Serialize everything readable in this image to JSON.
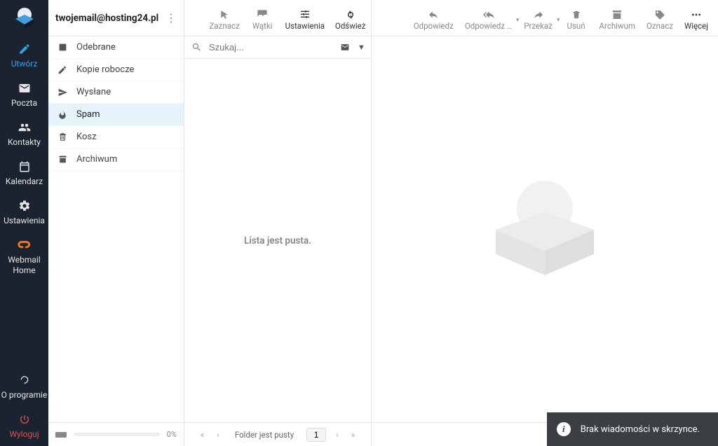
{
  "account": "twojemail@hosting24.pl",
  "vnav": {
    "compose": "Utwórz",
    "mail": "Poczta",
    "contacts": "Kontakty",
    "calendar": "Kalendarz",
    "settings": "Ustawienia",
    "webmail_home_l1": "Webmail",
    "webmail_home_l2": "Home",
    "about": "O programie",
    "logout": "Wyloguj"
  },
  "toolbar_left": {
    "select": "Zaznacz",
    "threads": "Wątki",
    "options": "Ustawienia",
    "refresh": "Odśwież"
  },
  "toolbar_right": {
    "reply": "Odpowiedz",
    "reply_all": "Odpowiedz …",
    "forward": "Przekaż",
    "delete": "Usuń",
    "archive": "Archiwum",
    "mark": "Oznacz",
    "more": "Więcej"
  },
  "folders": [
    {
      "name": "Odebrane",
      "icon": "inbox"
    },
    {
      "name": "Kopie robocze",
      "icon": "pencil"
    },
    {
      "name": "Wysłane",
      "icon": "plane"
    },
    {
      "name": "Spam",
      "icon": "fire",
      "selected": true
    },
    {
      "name": "Kosz",
      "icon": "trash"
    },
    {
      "name": "Archiwum",
      "icon": "archive"
    }
  ],
  "search": {
    "placeholder": "Szukaj..."
  },
  "list_empty": "Lista jest pusta.",
  "quota": {
    "percent": "0%"
  },
  "paginator": {
    "status": "Folder jest pusty",
    "page": "1"
  },
  "toast": "Brak wiadomości w skrzynce."
}
